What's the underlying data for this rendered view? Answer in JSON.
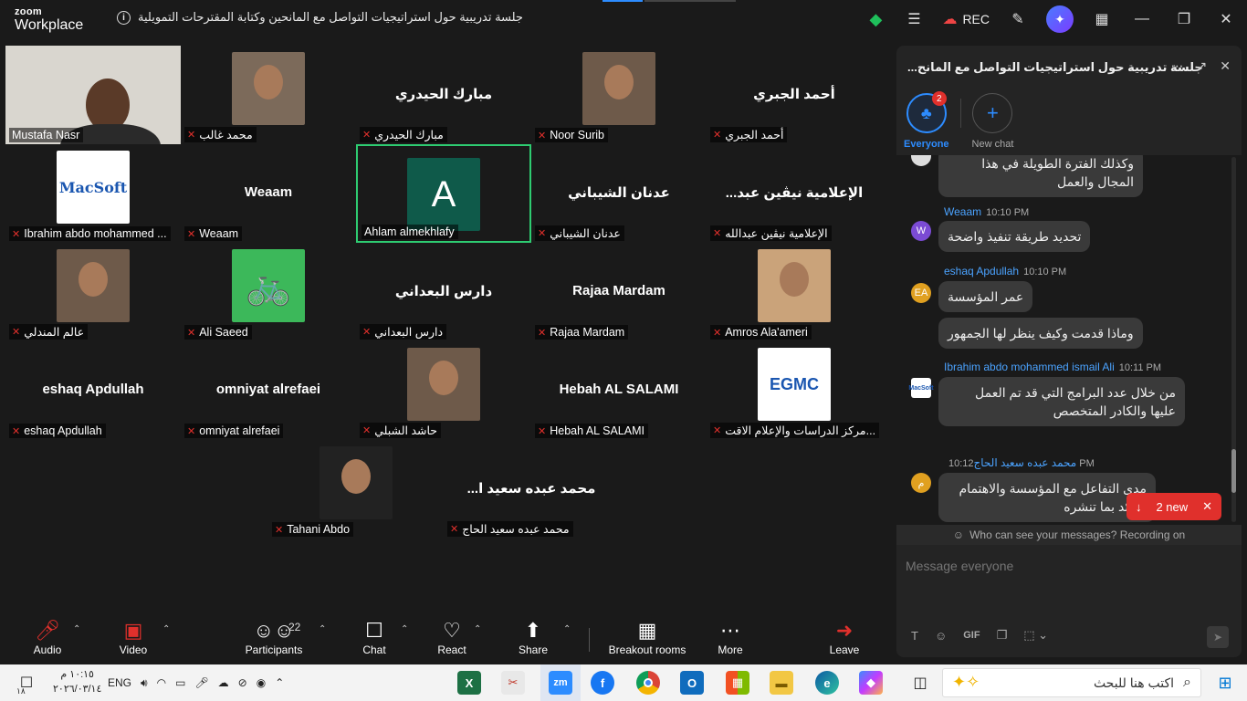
{
  "titlebar": {
    "logo_line1": "zoom",
    "logo_line2": "Workplace",
    "meeting_topic": "جلسة تدريبية حول استراتيجيات التواصل مع المانحين وكتابة المقترحات التمويلية",
    "rec_label": "REC"
  },
  "gallery": {
    "tiles": [
      {
        "label": "Mustafa Nasr",
        "big": "",
        "kind": "video"
      },
      {
        "label": "محمد غالب",
        "big": "",
        "kind": "photo"
      },
      {
        "label": "مبارك الحيدري",
        "big": "مبارك الحيدري",
        "kind": "name"
      },
      {
        "label": "Noor Surib",
        "big": "",
        "kind": "photo"
      },
      {
        "label": "أحمد الجبري",
        "big": "أحمد الجبري",
        "kind": "name"
      },
      {
        "label": "Ibrahim abdo mohammed ...",
        "big": "",
        "kind": "logo"
      },
      {
        "label": "Weaam",
        "big": "Weaam",
        "kind": "name"
      },
      {
        "label": "Ahlam almekhlafy",
        "big": "A",
        "kind": "initial"
      },
      {
        "label": "عدنان الشيباني",
        "big": "عدنان الشيباني",
        "kind": "name"
      },
      {
        "label": "الإعلامية نيڤين عبدالله",
        "big": "...الإعلامية نيڤين عبد",
        "kind": "name"
      },
      {
        "label": "عالم المندلي",
        "big": "",
        "kind": "photo"
      },
      {
        "label": "Ali Saeed",
        "big": "",
        "kind": "bike"
      },
      {
        "label": "دارس البعداني",
        "big": "دارس البعداني",
        "kind": "name"
      },
      {
        "label": "Rajaa Mardam",
        "big": "Rajaa Mardam",
        "kind": "name"
      },
      {
        "label": "Amros Ala'ameri",
        "big": "",
        "kind": "photo"
      },
      {
        "label": "eshaq Apdullah",
        "big": "eshaq Apdullah",
        "kind": "name"
      },
      {
        "label": "omniyat alrefaei",
        "big": "omniyat alrefaei",
        "kind": "name"
      },
      {
        "label": "حاشد الشبلي",
        "big": "",
        "kind": "photo"
      },
      {
        "label": "Hebah AL SALAMI",
        "big": "Hebah AL SALAMI",
        "kind": "name"
      },
      {
        "label": "مركز الدراسات والإعلام الاقت...",
        "big": "",
        "kind": "egmc"
      },
      {
        "label": "Tahani Abdo",
        "big": "",
        "kind": "photo"
      },
      {
        "label": "محمد عبده سعيد الحاج",
        "big": "...محمد عبده سعيد ا",
        "kind": "name"
      }
    ],
    "macsoft_text": "MacSoft",
    "egmc_text": "EGMC"
  },
  "toolbar": {
    "audio": "Audio",
    "video": "Video",
    "participants": "Participants",
    "participants_count": "22",
    "chat": "Chat",
    "react": "React",
    "share": "Share",
    "breakout": "Breakout rooms",
    "more": "More",
    "leave": "Leave"
  },
  "chat": {
    "title": "...جلسة تدريبية حول استراتيجيات التواصل مع المانح",
    "tab_everyone": "Everyone",
    "tab_everyone_badge": "2",
    "tab_new": "New chat",
    "messages": [
      {
        "author": "",
        "time": "",
        "avatar": "",
        "text": "وكذلك الفترة الطويلة في هذا المجال والعمل"
      },
      {
        "author": "Weaam",
        "time": "10:10 PM",
        "avatar": "W",
        "text": "تحديد طريقة تنفيذ واضحة"
      },
      {
        "author": "eshaq Apdullah",
        "time": "10:10 PM",
        "avatar": "EA",
        "text": "عمر المؤسسة"
      },
      {
        "author": "",
        "time": "",
        "avatar": "",
        "text": "وماذا قدمت وكيف ينظر لها الجمهور"
      },
      {
        "author": "Ibrahim abdo mohammed ismail Ali",
        "time": "10:11 PM",
        "avatar": "",
        "text": "من خلال عدد البرامج التي قد تم العمل عليها والكادر المتخصص"
      },
      {
        "author": "محمد عبده سعيد الحاج",
        "time": "10:12 PM",
        "avatar": "م",
        "text": "مدى التفاعل مع المؤسسة والاهتمام الزائد بما تنشره"
      }
    ],
    "new_pill": "2 new",
    "privacy_note": "Who can see your messages? Recording on",
    "compose_placeholder": "Message everyone",
    "gif": "GIF"
  },
  "taskbar": {
    "search_placeholder": "اكتب هنا للبحث",
    "time": "١٠:١٥ م",
    "date": "٢٠٢٦/٠٣/١٤",
    "lang": "ENG",
    "notif_count": "١٨"
  }
}
